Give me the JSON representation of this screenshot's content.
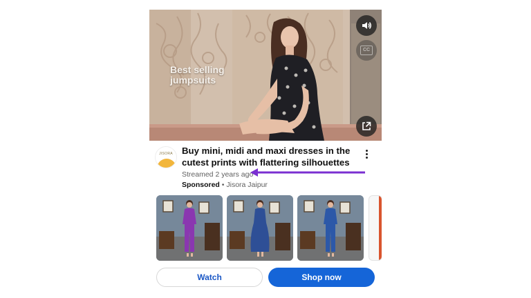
{
  "video": {
    "overlay_text": "Best selling jumpsuits",
    "controls": [
      "volume-icon",
      "closed-captions-icon",
      "open-external-icon"
    ],
    "cc_label": "CC"
  },
  "ad": {
    "channel_logo_text": "JISORA",
    "title": "Buy mini, midi and maxi dresses in the cutest prints with flattering silhouettes",
    "streamed": "Streamed 2 years ago",
    "sponsored": "Sponsored",
    "separator": "•",
    "advertiser": "Jisora Jaipur",
    "annotation_arrow_color": "#7a2fd1"
  },
  "products": [
    {
      "outfit_color": "#8a37b0"
    },
    {
      "outfit_color": "#2e4f96"
    },
    {
      "outfit_color": "#2c58a8"
    }
  ],
  "actions": {
    "watch": "Watch",
    "shop_now": "Shop now"
  },
  "colors": {
    "primary_button": "#1565d8",
    "link_text": "#1a57c5"
  }
}
